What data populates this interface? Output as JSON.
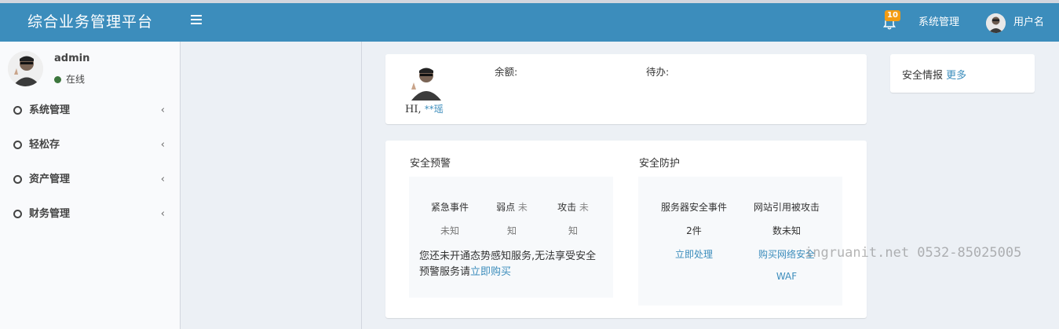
{
  "header": {
    "brand": "综合业务管理平台",
    "notification_count": "10",
    "system_menu": "系统管理",
    "username": "用户名"
  },
  "sidebar": {
    "user": {
      "name": "admin",
      "status": "在线"
    },
    "items": [
      {
        "label": "系统管理"
      },
      {
        "label": "轻松存"
      },
      {
        "label": "资产管理"
      },
      {
        "label": "财务管理"
      }
    ]
  },
  "welcome": {
    "greeting": "HI,",
    "user_masked": "**瑶",
    "balance_label": "余额:",
    "todo_label": "待办:"
  },
  "security_warning": {
    "title": "安全预警",
    "cols": [
      {
        "label": "紧急事件",
        "label_suffix": "",
        "value": "未知"
      },
      {
        "label": "弱点",
        "label_suffix": "未",
        "value": "知"
      },
      {
        "label": "攻击",
        "label_suffix": "未",
        "value": "知"
      }
    ],
    "message": "您还未开通态势感知服务,无法享受安全预警服务请",
    "buy_link": "立即购买"
  },
  "security_protection": {
    "title": "安全防护",
    "server_events_label": "服务器安全事件",
    "server_events_value": "2件",
    "handle_link": "立即处理",
    "site_attack_label": "网站引用被攻击",
    "site_attack_value": "数未知",
    "buy_link_line1": "购买网络安全",
    "buy_link_line2": "WAF"
  },
  "intel": {
    "title": "安全情报",
    "more_link": "更多"
  },
  "watermark": "ingruanit.net 0532-85025005",
  "colors": {
    "header_bg": "#3c8dbc",
    "link": "#3c8dbc",
    "badge": "#f39c12",
    "online_dot": "#3c763d"
  }
}
